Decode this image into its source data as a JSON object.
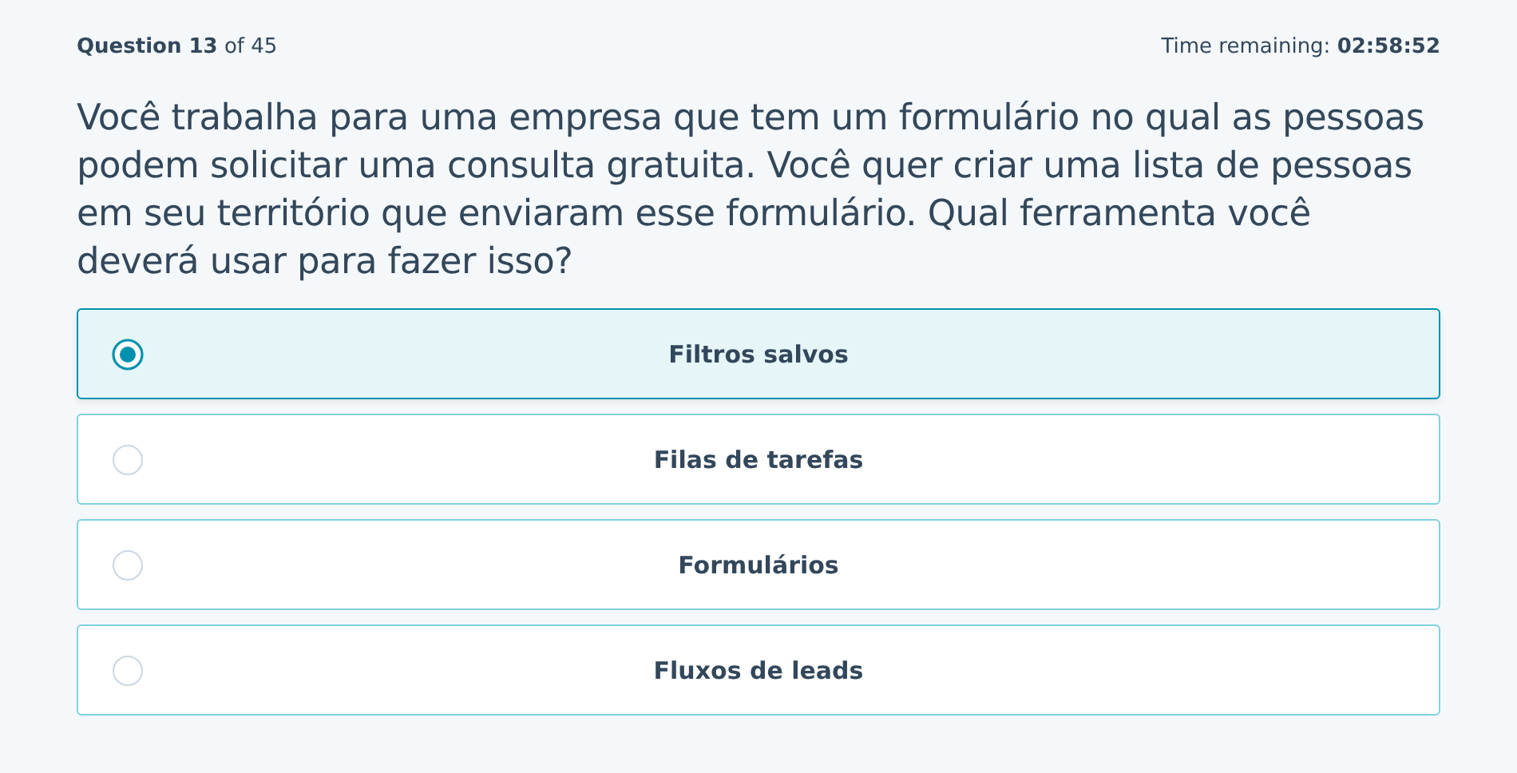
{
  "header": {
    "progress": "**Question 13** of 45",
    "timer": "Time remaining: **02:58:52**"
  },
  "question": "Você trabalha para uma empresa que tem um formulário no qual as pessoas podem solicitar uma consulta gratuita. Você quer criar uma lista de pessoas em seu território que enviaram esse formulário. Qual ferramenta você deverá usar para fazer isso?",
  "options": [
    {
      "label": "Filtros salvos",
      "selected": true
    },
    {
      "label": "Filas de tarefas",
      "selected": false
    },
    {
      "label": "Formulários",
      "selected": false
    },
    {
      "label": "Fluxos de leads",
      "selected": false
    }
  ]
}
